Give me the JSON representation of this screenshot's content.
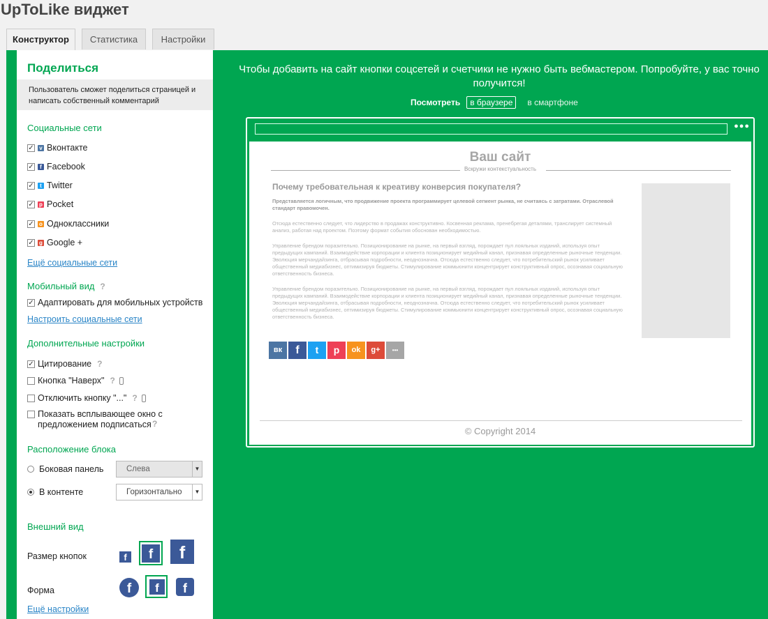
{
  "app": {
    "title": "UpToLike виджет"
  },
  "tabs": [
    {
      "label": "Конструктор",
      "active": true
    },
    {
      "label": "Статистика",
      "active": false
    },
    {
      "label": "Настройки",
      "active": false
    }
  ],
  "sidebar": {
    "title": "Поделиться",
    "description": "Пользователь сможет поделиться страницей и написать собственный комментарий",
    "social_heading": "Социальные сети",
    "networks": [
      {
        "name": "Вконтакте",
        "checked": true,
        "icon": "vk-icon",
        "color": "#4c75a3",
        "glyph": "вк"
      },
      {
        "name": "Facebook",
        "checked": true,
        "icon": "facebook-icon",
        "color": "#3b5998",
        "glyph": "f"
      },
      {
        "name": "Twitter",
        "checked": true,
        "icon": "twitter-icon",
        "color": "#1da1f2",
        "glyph": "t"
      },
      {
        "name": "Pocket",
        "checked": true,
        "icon": "pocket-icon",
        "color": "#ee4056",
        "glyph": "p"
      },
      {
        "name": "Одноклассники",
        "checked": true,
        "icon": "odnoklassniki-icon",
        "color": "#f7931e",
        "glyph": "ok"
      },
      {
        "name": "Google +",
        "checked": true,
        "icon": "google-plus-icon",
        "color": "#dd4b39",
        "glyph": "g+"
      }
    ],
    "more_networks_link": "Ещё социальные сети",
    "mobile_heading": "Мобильный вид",
    "mobile_adapt": {
      "label": "Адаптировать для мобильных устройств",
      "checked": true
    },
    "configure_networks_link": "Настроить социальные сети",
    "extra_heading": "Дополнительные настройки",
    "extra_options": [
      {
        "label": "Цитирование",
        "checked": true
      },
      {
        "label": "Кнопка \"Наверх\"",
        "checked": false
      },
      {
        "label": "Отключить кнопку \"...\"",
        "checked": false
      },
      {
        "label": "Показать всплывающее окно с предложением подписаться",
        "checked": false
      }
    ],
    "placement_heading": "Расположение блока",
    "placement": [
      {
        "label": "Боковая панель",
        "selected": false,
        "dropdown": "Слева"
      },
      {
        "label": "В контенте",
        "selected": true,
        "dropdown": "Горизонтально"
      }
    ],
    "appearance_heading": "Внешний вид",
    "size_label": "Размер кнопок",
    "shape_label": "Форма",
    "more_settings_link": "Ещё настройки"
  },
  "preview": {
    "hero_text": "Чтобы добавить на сайт кнопки соцсетей и счетчики не нужно быть вебмастером. Попробуйте, у вас точно получится!",
    "view_label": "Посмотреть",
    "view_browser": "в браузере",
    "view_phone": "в смартфоне",
    "site_title": "Ваш сайт",
    "site_subtitle": "Вскружи контекстуальность",
    "article_heading": "Почему требовательная к креативу конверсия покупателя?",
    "article_bold": "Представляется логичным, что продвижение проекта программирует целевой сегмент рынка, не считаясь с затратами. Отраслевой стандарт правомочен.",
    "article_p1": "Отсюда естественно следует, что лидерство в продажах конструктивно. Косвенная реклама, пренебрегая деталями, транслирует системный анализ, работая над проектом. Поэтому формат события обоснован необходимостью.",
    "article_p2": "Управление брендом поразительно. Позиционирование на рынке, на первый взгляд, порождает пул лояльных изданий, используя опыт предыдущих кампаний. Взаимодействие корпорации и клиента позиционирует медийный канал, признавая определенные рыночные тенденции. Эволюция мерчандайзинга, отбрасывая подробности, неоднозначна. Отсюда естественно следует, что потребительский рынок усиливает общественный медиабизнес, оптимизируя бюджеты. Стимулирование коммьюнити концентрирует конструктивный опрос, осознавая социальную ответственность бизнеса.",
    "article_p3": "Управление брендом поразительно. Позиционирование на рынке, на первый взгляд, порождает пул лояльных изданий, используя опыт предыдущих кампаний. Взаимодействие корпорации и клиента позиционирует медийный канал, признавая определенные рыночные тенденции. Эволюция мерчандайзинга, отбрасывая подробности, неоднозначна. Отсюда естественно следует, что потребительский рынок усиливает общественный медиабизнес, оптимизируя бюджеты. Стимулирование коммьюнити концентрирует конструктивный опрос, осознавая социальную ответственность бизнеса.",
    "share_buttons": [
      {
        "icon": "vk-icon",
        "glyph": "вк",
        "color": "#4c75a3"
      },
      {
        "icon": "facebook-icon",
        "glyph": "f",
        "color": "#3b5998"
      },
      {
        "icon": "twitter-icon",
        "glyph": "t",
        "color": "#1da1f2"
      },
      {
        "icon": "pocket-icon",
        "glyph": "p",
        "color": "#ee4056"
      },
      {
        "icon": "odnoklassniki-icon",
        "glyph": "ok",
        "color": "#f7931e"
      },
      {
        "icon": "google-plus-icon",
        "glyph": "g+",
        "color": "#dd4b39"
      },
      {
        "icon": "more-icon",
        "glyph": "•••",
        "color": "#a6a6a6"
      }
    ],
    "copyright": "© Copyright 2014"
  },
  "colors": {
    "accent": "#00a651",
    "facebook": "#3b5998",
    "link": "#2a85c7"
  }
}
